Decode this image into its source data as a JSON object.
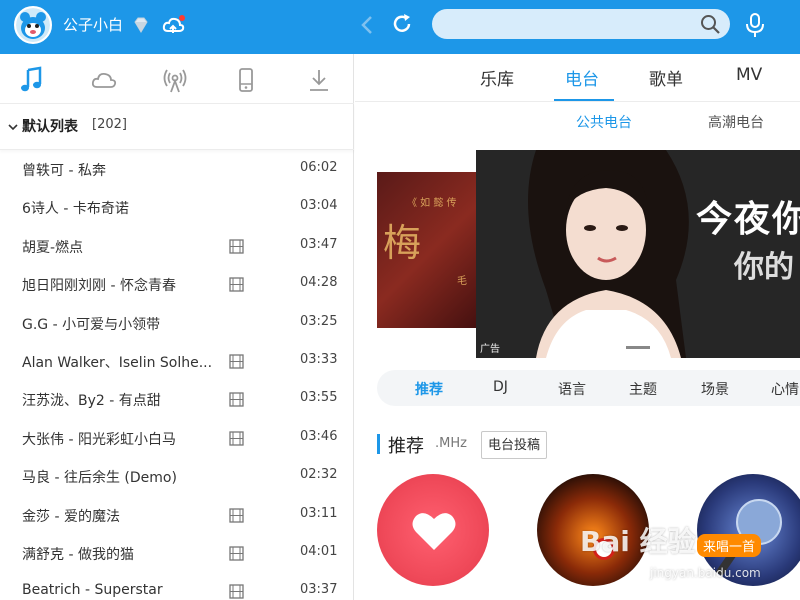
{
  "header": {
    "username": "公子小白",
    "search_placeholder": "",
    "icons": [
      "avatar",
      "diamond-icon",
      "cloud-icon",
      "back-icon",
      "refresh-icon",
      "search-icon",
      "mic-icon"
    ]
  },
  "sidebar": {
    "nav_icons": [
      "music-note-icon",
      "cloud-icon",
      "radio-icon",
      "device-icon",
      "download-icon"
    ],
    "list_title": "默认列表",
    "list_count": "[202]",
    "songs": [
      {
        "title": "曾轶可 - 私奔",
        "duration": "06:02",
        "mv": false
      },
      {
        "title": "6诗人 - 卡布奇诺",
        "duration": "03:04",
        "mv": false
      },
      {
        "title": "胡夏-燃点",
        "duration": "03:47",
        "mv": true
      },
      {
        "title": "旭日阳刚刘刚 - 怀念青春",
        "duration": "04:28",
        "mv": true
      },
      {
        "title": "G.G - 小可爱与小领带",
        "duration": "03:25",
        "mv": false
      },
      {
        "title": "Alan Walker、Iselin Solhe...",
        "duration": "03:33",
        "mv": true
      },
      {
        "title": "汪苏泷、By2 - 有点甜",
        "duration": "03:55",
        "mv": true
      },
      {
        "title": "大张伟 - 阳光彩虹小白马",
        "duration": "03:46",
        "mv": true
      },
      {
        "title": "马良 - 往后余生 (Demo)",
        "duration": "02:32",
        "mv": false
      },
      {
        "title": "金莎 - 爱的魔法",
        "duration": "03:11",
        "mv": true
      },
      {
        "title": "满舒克 - 做我的猫",
        "duration": "04:01",
        "mv": true
      },
      {
        "title": "Beatrich - Superstar",
        "duration": "03:37",
        "mv": true
      }
    ]
  },
  "main": {
    "tabs": [
      {
        "label": "乐库",
        "active": false
      },
      {
        "label": "电台",
        "active": true
      },
      {
        "label": "歌单",
        "active": false
      },
      {
        "label": "MV",
        "active": false
      }
    ],
    "subtabs": [
      {
        "label": "公共电台",
        "active": true
      },
      {
        "label": "高潮电台",
        "active": false
      }
    ],
    "banner_back": {
      "text": "梅",
      "sub_top": "《 如 懿 传",
      "sub_bottom": "毛"
    },
    "banner_front": {
      "headline": "今夜你",
      "sub": "你的",
      "ad_label": "广告"
    },
    "categories": [
      {
        "label": "推荐",
        "active": true
      },
      {
        "label": "DJ",
        "active": false
      },
      {
        "label": "语言",
        "active": false
      },
      {
        "label": "主题",
        "active": false
      },
      {
        "label": "场景",
        "active": false
      },
      {
        "label": "心情",
        "active": false
      }
    ],
    "section": {
      "title": "推荐",
      "sub": ".MHz",
      "button": "电台投稿"
    },
    "tile_tag": "来唱一首"
  },
  "watermark": {
    "text": "Bai 经验",
    "sub": "jingyan.baidu.com"
  },
  "colors": {
    "accent": "#1d97e8",
    "heart_tile": "#f04a5a",
    "tag_orange": "#ff8a00"
  }
}
